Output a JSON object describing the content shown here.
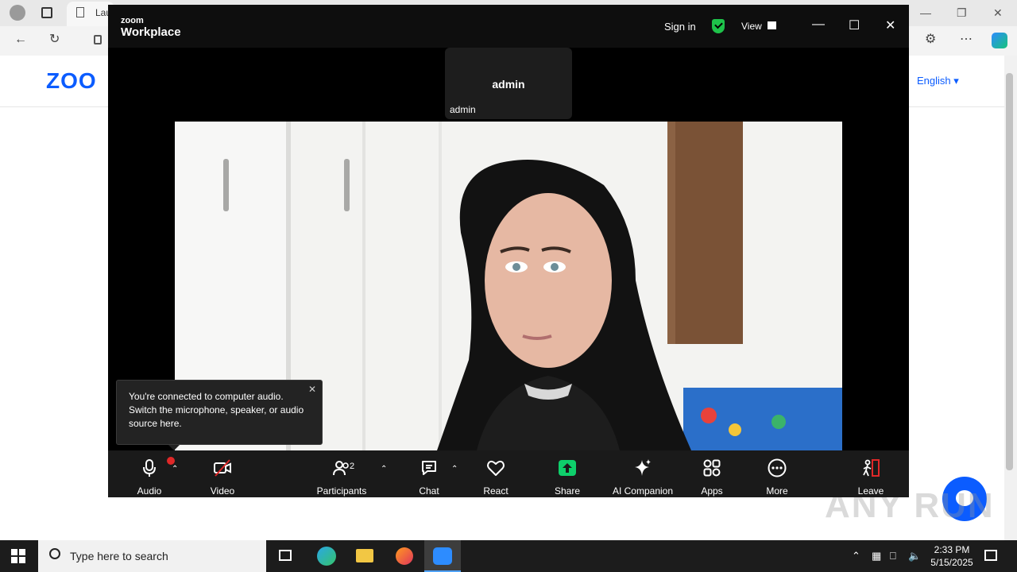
{
  "browser": {
    "tab_title": "Lau",
    "logo_text": "ZOO",
    "language": "English"
  },
  "zoom_window": {
    "brand_small": "zoom",
    "brand": "Workplace",
    "sign_in": "Sign in",
    "view": "View",
    "participant_tile": {
      "name": "admin",
      "label": "admin"
    },
    "tooltip": {
      "text": "You're connected to computer audio. Switch the microphone, speaker, or audio source here."
    },
    "toolbar": {
      "audio": "Audio",
      "video": "Video",
      "participants": "Participants",
      "participants_count": "2",
      "chat": "Chat",
      "react": "React",
      "share": "Share",
      "ai_companion": "AI Companion",
      "apps": "Apps",
      "more": "More",
      "leave": "Leave"
    }
  },
  "watermark": "ANY RUN",
  "taskbar": {
    "search_placeholder": "Type here to search",
    "time": "2:33 PM",
    "date": "5/15/2025"
  },
  "colors": {
    "zoom_blue": "#0b5cff",
    "share_green": "#0ecf6b",
    "leave_red": "#e02828",
    "shield_green": "#1ec24a"
  }
}
